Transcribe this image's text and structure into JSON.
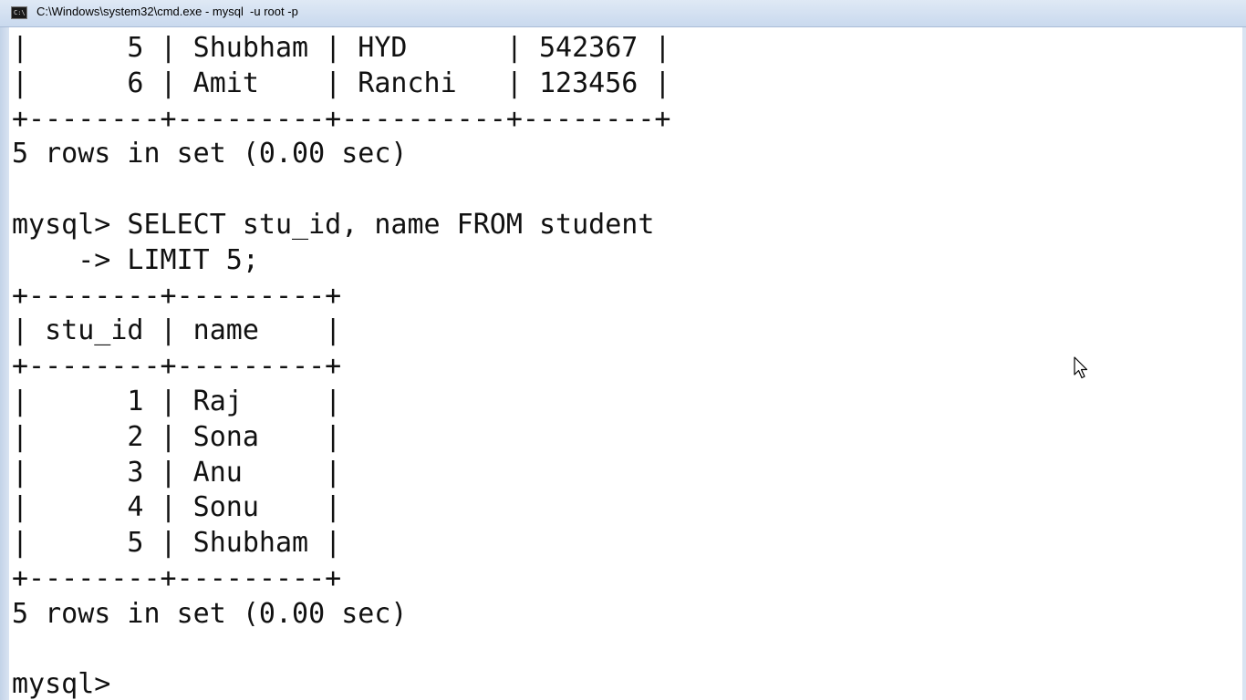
{
  "window": {
    "title": "C:\\Windows\\system32\\cmd.exe - mysql  -u root -p",
    "icon": "console-icon",
    "icon_text": "C:\\"
  },
  "console": {
    "lines": [
      "|      5 | Shubham | HYD      | 542367 |",
      "|      6 | Amit    | Ranchi   | 123456 |",
      "+--------+---------+----------+--------+",
      "5 rows in set (0.00 sec)",
      "",
      "mysql> SELECT stu_id, name FROM student",
      "    -> LIMIT 5;",
      "+--------+---------+",
      "| stu_id | name    |",
      "+--------+---------+",
      "|      1 | Raj     |",
      "|      2 | Sona    |",
      "|      3 | Anu     |",
      "|      4 | Sonu    |",
      "|      5 | Shubham |",
      "+--------+---------+",
      "5 rows in set (0.00 sec)",
      "",
      "mysql> "
    ]
  },
  "cursor": {
    "icon": "mouse-pointer-icon"
  }
}
